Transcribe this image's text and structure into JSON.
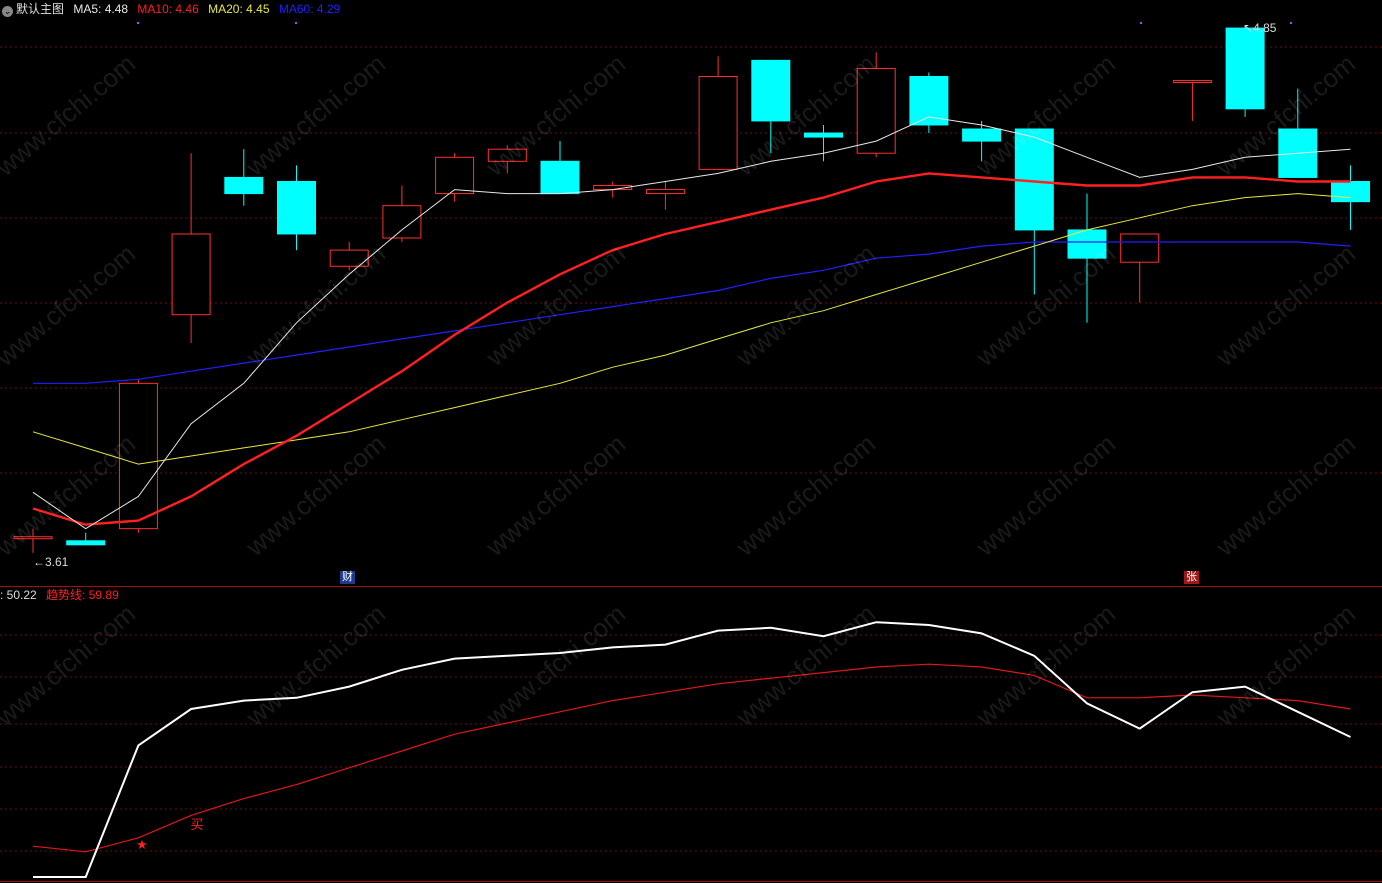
{
  "main_legend": {
    "title": "默认主图",
    "ma5_label": "MA5: 4.48",
    "ma10_label": "MA10: 4.46",
    "ma20_label": "MA20: 4.45",
    "ma60_label": "MA60: 4.29",
    "colors": {
      "ma5": "#e8e8e8",
      "ma10": "#ff2020",
      "ma20": "#e8e840",
      "ma60": "#2020ff",
      "up": "#ff3030",
      "down": "#00ffff"
    }
  },
  "indicator_legend": {
    "value_label": ": 50.22",
    "trend_label": "趋势线: 59.89"
  },
  "markers": {
    "cai": "财",
    "zhang": "张"
  },
  "price_labels": {
    "low": "3.61",
    "high": "4.85"
  },
  "watermark": "www.cfchi.com",
  "chart_data": [
    {
      "type": "candlestick",
      "ylim": [
        3.55,
        4.9
      ],
      "candles": [
        {
          "o": 3.62,
          "h": 3.64,
          "l": 3.58,
          "c": 3.62
        },
        {
          "o": 3.61,
          "h": 3.63,
          "l": 3.6,
          "c": 3.6
        },
        {
          "o": 3.64,
          "h": 4.01,
          "l": 3.63,
          "c": 4.0
        },
        {
          "o": 4.17,
          "h": 4.57,
          "l": 4.1,
          "c": 4.37
        },
        {
          "o": 4.51,
          "h": 4.58,
          "l": 4.44,
          "c": 4.47
        },
        {
          "o": 4.5,
          "h": 4.54,
          "l": 4.33,
          "c": 4.37
        },
        {
          "o": 4.29,
          "h": 4.35,
          "l": 4.28,
          "c": 4.33
        },
        {
          "o": 4.36,
          "h": 4.49,
          "l": 4.35,
          "c": 4.44
        },
        {
          "o": 4.47,
          "h": 4.57,
          "l": 4.45,
          "c": 4.56
        },
        {
          "o": 4.55,
          "h": 4.59,
          "l": 4.52,
          "c": 4.58
        },
        {
          "o": 4.55,
          "h": 4.6,
          "l": 4.47,
          "c": 4.47
        },
        {
          "o": 4.48,
          "h": 4.5,
          "l": 4.46,
          "c": 4.49
        },
        {
          "o": 4.47,
          "h": 4.5,
          "l": 4.43,
          "c": 4.48
        },
        {
          "o": 4.53,
          "h": 4.81,
          "l": 4.53,
          "c": 4.76
        },
        {
          "o": 4.8,
          "h": 4.8,
          "l": 4.57,
          "c": 4.65
        },
        {
          "o": 4.62,
          "h": 4.64,
          "l": 4.55,
          "c": 4.61
        },
        {
          "o": 4.57,
          "h": 4.82,
          "l": 4.56,
          "c": 4.78
        },
        {
          "o": 4.76,
          "h": 4.77,
          "l": 4.62,
          "c": 4.64
        },
        {
          "o": 4.63,
          "h": 4.65,
          "l": 4.55,
          "c": 4.6
        },
        {
          "o": 4.63,
          "h": 4.63,
          "l": 4.22,
          "c": 4.38
        },
        {
          "o": 4.38,
          "h": 4.47,
          "l": 4.15,
          "c": 4.31
        },
        {
          "o": 4.3,
          "h": 4.37,
          "l": 4.2,
          "c": 4.37
        },
        {
          "o": 4.75,
          "h": 4.75,
          "l": 4.65,
          "c": 4.75
        },
        {
          "o": 4.88,
          "h": 4.88,
          "l": 4.66,
          "c": 4.68
        },
        {
          "o": 4.63,
          "h": 4.73,
          "l": 4.61,
          "c": 4.51
        },
        {
          "o": 4.5,
          "h": 4.54,
          "l": 4.38,
          "c": 4.45
        }
      ],
      "ma5": [
        3.73,
        3.64,
        3.72,
        3.9,
        4.0,
        4.15,
        4.27,
        4.38,
        4.48,
        4.47,
        4.47,
        4.48,
        4.5,
        4.52,
        4.55,
        4.57,
        4.6,
        4.66,
        4.64,
        4.61,
        4.56,
        4.51,
        4.53,
        4.56,
        4.57,
        4.58
      ],
      "ma10": [
        3.69,
        3.65,
        3.66,
        3.72,
        3.8,
        3.87,
        3.95,
        4.03,
        4.12,
        4.2,
        4.27,
        4.33,
        4.37,
        4.4,
        4.43,
        4.46,
        4.5,
        4.52,
        4.51,
        4.5,
        4.49,
        4.49,
        4.51,
        4.51,
        4.5,
        4.5
      ],
      "ma20": [
        3.88,
        3.84,
        3.8,
        3.82,
        3.84,
        3.86,
        3.88,
        3.91,
        3.94,
        3.97,
        4.0,
        4.04,
        4.07,
        4.11,
        4.15,
        4.18,
        4.22,
        4.26,
        4.3,
        4.34,
        4.38,
        4.41,
        4.44,
        4.46,
        4.47,
        4.46
      ],
      "ma60": [
        4.0,
        4.0,
        4.01,
        4.03,
        4.05,
        4.07,
        4.09,
        4.11,
        4.13,
        4.15,
        4.17,
        4.19,
        4.21,
        4.23,
        4.26,
        4.28,
        4.31,
        4.32,
        4.34,
        4.35,
        4.35,
        4.35,
        4.35,
        4.35,
        4.35,
        4.34
      ]
    },
    {
      "type": "line",
      "ylim": [
        0,
        100
      ],
      "series": [
        {
          "name": "",
          "values": [
            0,
            0,
            47,
            60,
            63,
            64,
            68,
            74,
            78,
            79,
            80,
            82,
            83,
            88,
            89,
            86,
            91,
            90,
            87,
            79,
            62,
            53,
            66,
            68,
            59,
            50
          ]
        },
        {
          "name": "趋势线",
          "values": [
            11,
            9,
            14,
            22,
            28,
            33,
            39,
            45,
            51,
            55,
            59,
            63,
            66,
            69,
            71,
            73,
            75,
            76,
            75,
            72,
            64,
            64,
            65,
            64,
            63,
            60
          ]
        }
      ],
      "annotations": [
        "★",
        "买"
      ]
    }
  ]
}
